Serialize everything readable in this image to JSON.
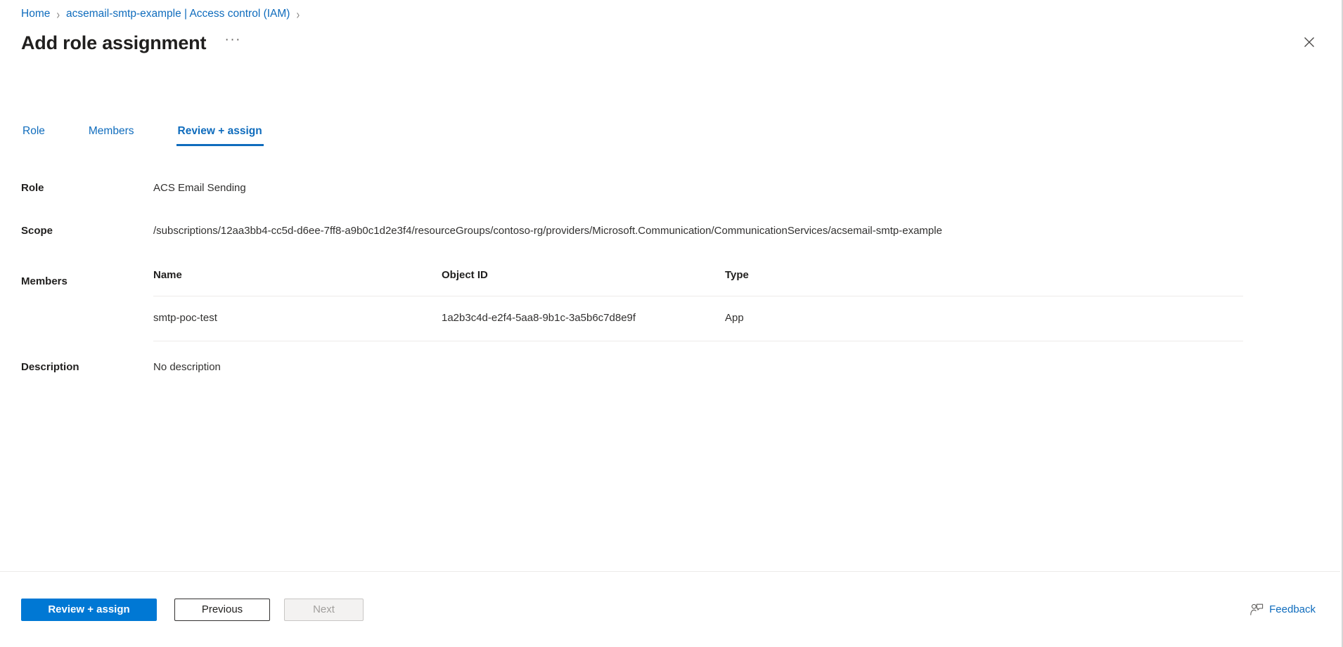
{
  "breadcrumb": {
    "items": [
      {
        "label": "Home"
      },
      {
        "label": "acsemail-smtp-example | Access control (IAM)"
      }
    ],
    "separator": "›"
  },
  "header": {
    "title": "Add role assignment",
    "context_menu_label": "···",
    "close_label": "Close",
    "close_icon": "close-icon"
  },
  "tabs": [
    {
      "label": "Role",
      "active": false
    },
    {
      "label": "Members",
      "active": false
    },
    {
      "label": "Review + assign",
      "active": true
    }
  ],
  "summary": {
    "role": {
      "label": "Role",
      "value": "ACS Email Sending"
    },
    "scope": {
      "label": "Scope",
      "value": "/subscriptions/12aa3bb4-cc5d-d6ee-7ff8-a9b0c1d2e3f4/resourceGroups/contoso-rg/providers/Microsoft.Communication/CommunicationServices/acsemail-smtp-example"
    },
    "members": {
      "label": "Members",
      "columns": [
        "Name",
        "Object ID",
        "Type"
      ],
      "rows": [
        {
          "name": "smtp-poc-test",
          "object_id": "1a2b3c4d-e2f4-5aa8-9b1c-3a5b6c7d8e9f",
          "type": "App"
        }
      ]
    },
    "description": {
      "label": "Description",
      "value": "No description"
    }
  },
  "footer": {
    "primary_button": "Review + assign",
    "previous_button": "Previous",
    "next_button": "Next",
    "next_disabled": true,
    "feedback_label": "Feedback",
    "feedback_icon": "person-feedback-icon"
  },
  "colors": {
    "accent_blue": "#0078d4",
    "link_blue": "#0f6cbd",
    "text_primary": "#201f1e",
    "text_secondary": "#323130",
    "divider": "#edebe9",
    "disabled_text": "#a19f9d"
  }
}
